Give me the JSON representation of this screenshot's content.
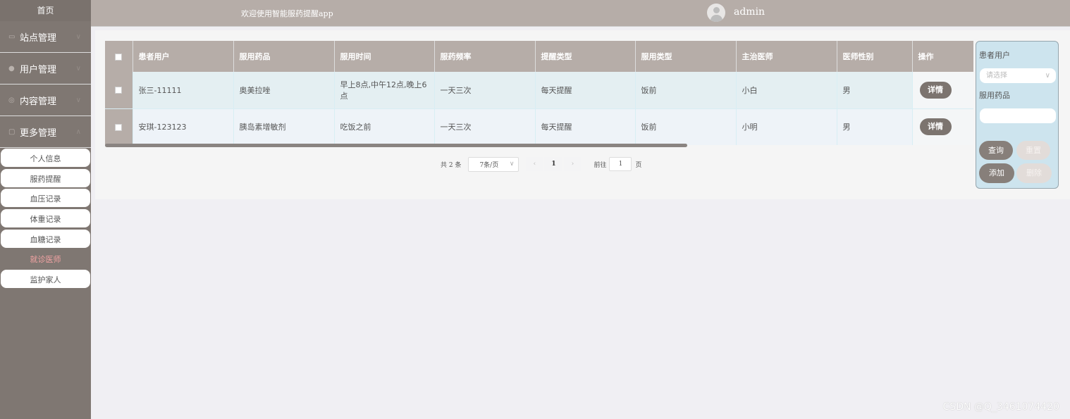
{
  "sidebar": {
    "home": "首页",
    "groups": [
      {
        "label": "站点管理",
        "icon": "monitor-icon"
      },
      {
        "label": "用户管理",
        "icon": "user-icon"
      },
      {
        "label": "内容管理",
        "icon": "content-icon"
      },
      {
        "label": "更多管理",
        "icon": "more-icon"
      }
    ],
    "sub_items": [
      "个人信息",
      "服药提醒",
      "血压记录",
      "体重记录",
      "血糖记录",
      "就诊医师",
      "监护家人"
    ],
    "active_sub": "就诊医师"
  },
  "header": {
    "welcome": "欢迎使用智能服药提醒app",
    "username": "admin"
  },
  "table": {
    "columns": [
      "患者用户",
      "服用药品",
      "服用时间",
      "服药频率",
      "提醒类型",
      "服用类型",
      "主治医师",
      "医师性别",
      "操作"
    ],
    "rows": [
      {
        "patient": "张三-11111",
        "drug": "奥美拉唑",
        "time": "早上8点,中午12点,晚上6点",
        "frequency": "一天三次",
        "remind_type": "每天提醒",
        "take_type": "饭前",
        "doctor": "小白",
        "gender": "男",
        "action": "详情"
      },
      {
        "patient": "安琪-123123",
        "drug": "胰岛素增敏剂",
        "time": "吃饭之前",
        "frequency": "一天三次",
        "remind_type": "每天提醒",
        "take_type": "饭前",
        "doctor": "小明",
        "gender": "男",
        "action": "详情"
      }
    ]
  },
  "pagination": {
    "total": "共 2 条",
    "page_size": "7条/页",
    "prev": "‹",
    "current": "1",
    "next": "›",
    "goto_label": "前往",
    "goto_value": "1",
    "page_suffix": "页"
  },
  "search": {
    "patient_label": "患者用户",
    "patient_placeholder": "请选择",
    "drug_label": "服用药品",
    "drug_value": "",
    "query": "查询",
    "reset": "重置",
    "add": "添加",
    "delete": "删除"
  },
  "watermark": "CSDN @Q_3461074420"
}
